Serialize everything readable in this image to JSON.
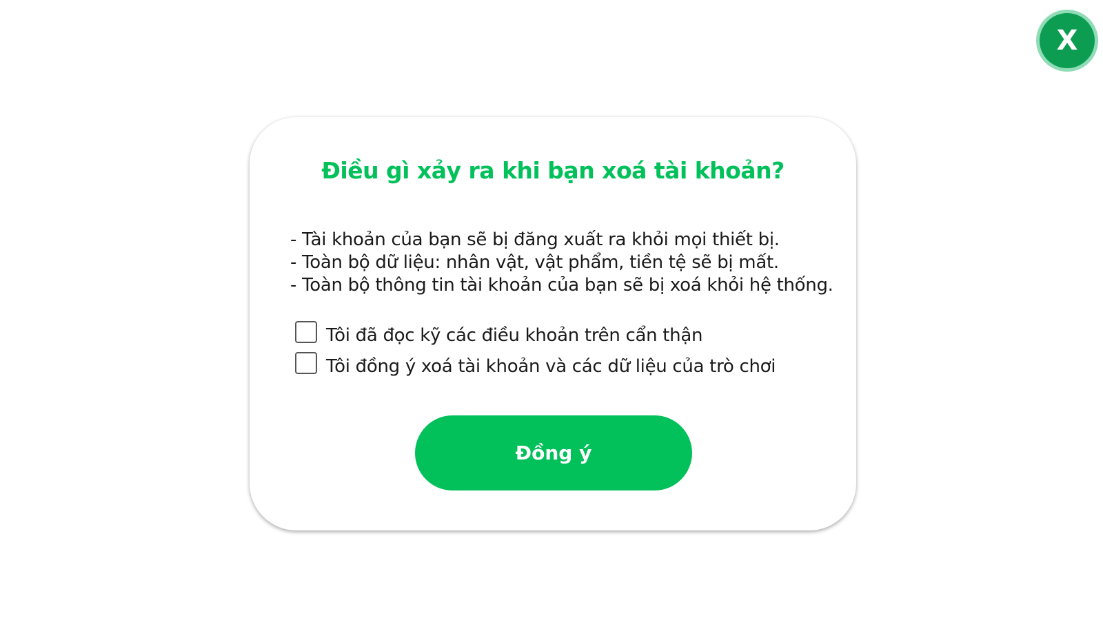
{
  "close_button": {
    "label": "X"
  },
  "dialog": {
    "title": "Điều gì xảy ra khi bạn xoá tài khoản?",
    "consequences": [
      "- Tài khoản của bạn sẽ bị đăng xuất ra khỏi mọi thiết bị.",
      "- Toàn bộ dữ liệu: nhân vật, vật phẩm, tiền tệ sẽ bị mất.",
      "- Toàn bộ thông tin tài khoản của bạn sẽ bị xoá khỏi hệ thống."
    ],
    "checkboxes": [
      {
        "label": "Tôi đã đọc kỹ các điều khoản trên cẩn thận",
        "checked": false
      },
      {
        "label": "Tôi đồng ý xoá tài khoản và các dữ liệu của trò chơi",
        "checked": false
      }
    ],
    "confirm_label": "Đồng ý"
  },
  "colors": {
    "accent": "#02c05a",
    "close_bg": "#0d9d52",
    "close_ring": "#8fdcb6",
    "text": "#1a1a1a"
  }
}
